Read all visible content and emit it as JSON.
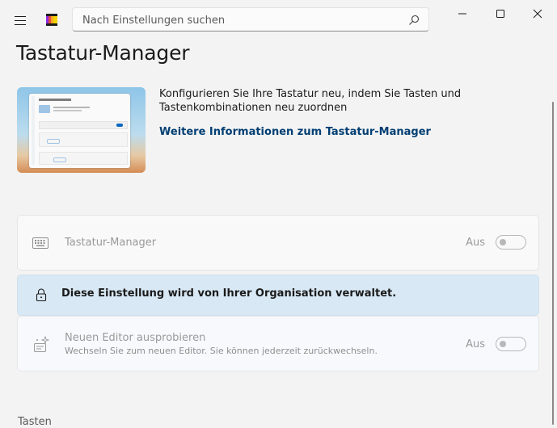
{
  "header": {
    "search_placeholder": "Nach Einstellungen suchen"
  },
  "page": {
    "title": "Tastatur-Manager",
    "description": "Konfigurieren Sie Ihre Tastatur neu, indem Sie Tasten und Tastenkombinationen neu zuordnen",
    "learn_more": "Weitere Informationen zum Tastatur-Manager"
  },
  "enable_card": {
    "label": "Tastatur-Manager",
    "state": "Aus",
    "enabled": false
  },
  "policy_banner": {
    "text": "Diese Einstellung wird von Ihrer Organisation verwaltet."
  },
  "editor_card": {
    "label": "Neuen Editor ausprobieren",
    "sublabel": "Wechseln Sie zum neuen Editor. Sie können jederzeit zurückwechseln.",
    "state": "Aus",
    "enabled": false
  },
  "section": {
    "keys_label": "Tasten"
  },
  "icons": {
    "menu": "hamburger-menu-icon",
    "app": "powertoys-app-icon",
    "search": "search-icon",
    "minimize": "minimize-icon",
    "maximize": "maximize-icon",
    "close": "close-icon",
    "keyboard": "keyboard-icon",
    "lock": "lock-icon",
    "editor": "editor-sparkle-icon"
  },
  "colors": {
    "link": "#003e73",
    "banner_bg": "#d8e8f4",
    "background": "#f3f3f3"
  }
}
